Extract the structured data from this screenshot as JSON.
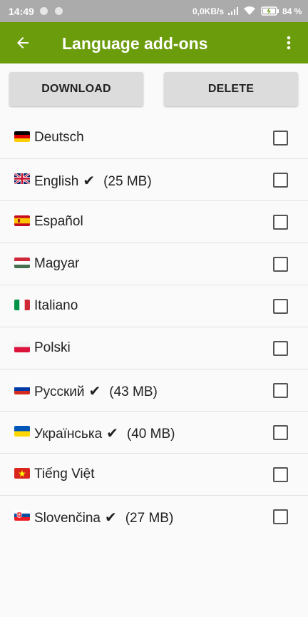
{
  "status": {
    "time": "14:49",
    "speed": "0,0KB/s",
    "battery": "84 %"
  },
  "appbar": {
    "title": "Language add-ons",
    "back_icon": "arrow-left-icon",
    "more_icon": "more-vert-icon",
    "color": "#6b9c0b"
  },
  "buttons": {
    "download": "DOWNLOAD",
    "delete": "DELETE"
  },
  "languages": [
    {
      "name": "Deutsch",
      "flag": "de",
      "installed": false,
      "size": "",
      "checked": false
    },
    {
      "name": "English",
      "flag": "gb",
      "installed": true,
      "size": "(25 MB)",
      "checked": false
    },
    {
      "name": "Español",
      "flag": "es",
      "installed": false,
      "size": "",
      "checked": false
    },
    {
      "name": "Magyar",
      "flag": "hu",
      "installed": false,
      "size": "",
      "checked": false
    },
    {
      "name": "Italiano",
      "flag": "it",
      "installed": false,
      "size": "",
      "checked": false
    },
    {
      "name": "Polski",
      "flag": "pl",
      "installed": false,
      "size": "",
      "checked": false
    },
    {
      "name": "Русский",
      "flag": "ru",
      "installed": true,
      "size": "(43 MB)",
      "checked": false
    },
    {
      "name": "Українська",
      "flag": "ua",
      "installed": true,
      "size": "(40 MB)",
      "checked": false
    },
    {
      "name": "Tiếng Việt",
      "flag": "vn",
      "installed": false,
      "size": "",
      "checked": false
    },
    {
      "name": "Slovenčina",
      "flag": "sk",
      "installed": true,
      "size": "(27 MB)",
      "checked": false
    }
  ],
  "check_mark": "✔"
}
